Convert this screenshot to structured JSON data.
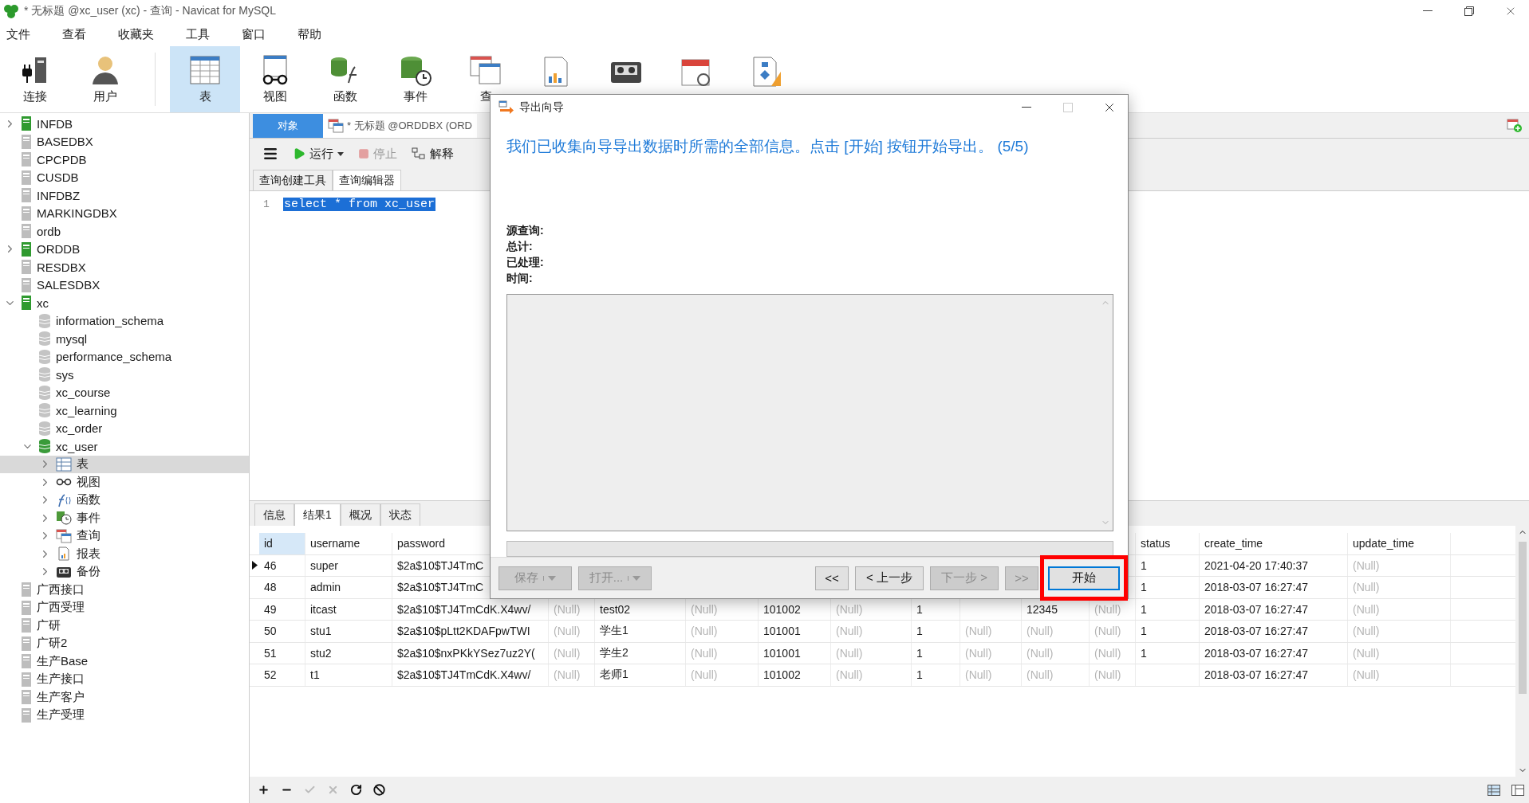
{
  "window": {
    "title": "* 无标题 @xc_user (xc) - 查询 - Navicat for MySQL"
  },
  "menu": [
    "文件",
    "查看",
    "收藏夹",
    "工具",
    "窗口",
    "帮助"
  ],
  "toolbar": [
    {
      "label": "连接",
      "selected": false
    },
    {
      "label": "用户",
      "selected": false
    },
    {
      "label": "表",
      "selected": true
    },
    {
      "label": "视图",
      "selected": false
    },
    {
      "label": "函数",
      "selected": false
    },
    {
      "label": "事件",
      "selected": false
    },
    {
      "label": "查",
      "selected": false
    },
    {
      "selected": false
    },
    {
      "selected": false
    },
    {
      "selected": false
    },
    {
      "selected": false
    }
  ],
  "tree": [
    {
      "label": "INFDB",
      "kind": "connection",
      "active": true,
      "expanded": false,
      "selected": false
    },
    {
      "label": "BASEDBX",
      "kind": "connection",
      "active": false,
      "selected": false
    },
    {
      "label": "CPCPDB",
      "kind": "connection",
      "active": false,
      "selected": false
    },
    {
      "label": "CUSDB",
      "kind": "connection",
      "active": false,
      "selected": false
    },
    {
      "label": "INFDBZ",
      "kind": "connection",
      "active": false,
      "selected": false
    },
    {
      "label": "MARKINGDBX",
      "kind": "connection",
      "active": false,
      "selected": false
    },
    {
      "label": "ordb",
      "kind": "connection",
      "active": false,
      "selected": false
    },
    {
      "label": "ORDDB",
      "kind": "connection",
      "active": true,
      "expanded": false,
      "selected": false
    },
    {
      "label": "RESDBX",
      "kind": "connection",
      "active": false,
      "selected": false
    },
    {
      "label": "SALESDBX",
      "kind": "connection",
      "active": false,
      "selected": false
    },
    {
      "label": "xc",
      "kind": "connection",
      "active": true,
      "expanded": true,
      "selected": false,
      "children": [
        {
          "label": "information_schema",
          "kind": "database",
          "active": false,
          "selected": false
        },
        {
          "label": "mysql",
          "kind": "database",
          "active": false,
          "selected": false
        },
        {
          "label": "performance_schema",
          "kind": "database",
          "active": false,
          "selected": false
        },
        {
          "label": "sys",
          "kind": "database",
          "active": false,
          "selected": false
        },
        {
          "label": "xc_course",
          "kind": "database",
          "active": false,
          "selected": false
        },
        {
          "label": "xc_learning",
          "kind": "database",
          "active": false,
          "selected": false
        },
        {
          "label": "xc_order",
          "kind": "database",
          "active": false,
          "selected": false
        },
        {
          "label": "xc_user",
          "kind": "database",
          "active": true,
          "expanded": true,
          "selected": false,
          "children": [
            {
              "label": "表",
              "kind": "category",
              "expanded": false,
              "selected": true
            },
            {
              "label": "视图",
              "kind": "category",
              "expanded": false,
              "selected": false
            },
            {
              "label": "函数",
              "kind": "category",
              "expanded": false,
              "selected": false
            },
            {
              "label": "事件",
              "kind": "category",
              "expanded": false,
              "selected": false
            },
            {
              "label": "查询",
              "kind": "category",
              "expanded": false,
              "selected": false
            },
            {
              "label": "报表",
              "kind": "category",
              "expanded": false,
              "selected": false
            },
            {
              "label": "备份",
              "kind": "category",
              "expanded": false,
              "selected": false
            }
          ]
        }
      ]
    },
    {
      "label": "广西接口",
      "kind": "connection",
      "active": false,
      "selected": false
    },
    {
      "label": "广西受理",
      "kind": "connection",
      "active": false,
      "selected": false
    },
    {
      "label": "广研",
      "kind": "connection",
      "active": false,
      "selected": false
    },
    {
      "label": "广研2",
      "kind": "connection",
      "active": false,
      "selected": false
    },
    {
      "label": "生产Base",
      "kind": "connection",
      "active": false,
      "selected": false
    },
    {
      "label": "生产接口",
      "kind": "connection",
      "active": false,
      "selected": false
    },
    {
      "label": "生产客户",
      "kind": "connection",
      "active": false,
      "selected": false
    },
    {
      "label": "生产受理",
      "kind": "connection",
      "active": false,
      "selected": false
    }
  ],
  "tabs": [
    {
      "label": "对象",
      "selected": true
    },
    {
      "label": "* 无标题 @ORDDBX (ORD",
      "selected": false
    }
  ],
  "query_toolbar": [
    {
      "label": "运行",
      "kind": "run",
      "disabled": false
    },
    {
      "label": "停止",
      "kind": "stop",
      "disabled": true
    },
    {
      "label": "解释",
      "kind": "explain",
      "disabled": false
    }
  ],
  "editor_tabs": [
    {
      "label": "查询创建工具",
      "selected": false
    },
    {
      "label": "查询编辑器",
      "selected": true
    }
  ],
  "editor": {
    "lines": [
      {
        "number": "1",
        "text": "select * from xc_user",
        "selected": true
      }
    ]
  },
  "result_tabs": [
    {
      "label": "信息",
      "selected": false
    },
    {
      "label": "结果1",
      "selected": true
    },
    {
      "label": "概况",
      "selected": false
    },
    {
      "label": "状态",
      "selected": false
    }
  ],
  "table": {
    "columns": [
      {
        "label": "id",
        "selected": true
      },
      {
        "label": "username",
        "selected": false
      },
      {
        "label": "password",
        "selected": false
      },
      null,
      null,
      null,
      null,
      null,
      null,
      null,
      null,
      null,
      {
        "label": "status",
        "selected": false
      },
      {
        "label": "create_time",
        "selected": false
      },
      {
        "label": "update_time",
        "selected": false
      }
    ],
    "rows": [
      {
        "current": true,
        "cells": [
          "46",
          "super",
          "$2a$10$TJ4TmC",
          null,
          null,
          null,
          null,
          null,
          null,
          null,
          null,
          null,
          "1",
          "2021-04-20 17:40:37",
          {
            "text": "(Null)",
            "kind": "null"
          }
        ]
      },
      {
        "current": false,
        "cells": [
          "48",
          "admin",
          "$2a$10$TJ4TmC",
          null,
          null,
          null,
          null,
          null,
          null,
          null,
          null,
          null,
          "1",
          "2018-03-07 16:27:47",
          {
            "text": "(Null)",
            "kind": "null"
          }
        ]
      },
      {
        "current": false,
        "cells": [
          "49",
          "itcast",
          "$2a$10$TJ4TmCdK.X4wv/",
          {
            "text": "(Null)",
            "kind": "null"
          },
          "test02",
          {
            "text": "(Null)",
            "kind": "null"
          },
          "101002",
          {
            "text": "(Null)",
            "kind": "null"
          },
          "1",
          null,
          "12345",
          {
            "text": "(Null)",
            "kind": "null"
          },
          "1",
          "2018-03-07 16:27:47",
          {
            "text": "(Null)",
            "kind": "null"
          }
        ]
      },
      {
        "current": false,
        "cells": [
          "50",
          "stu1",
          "$2a$10$pLtt2KDAFpwTWI",
          {
            "text": "(Null)",
            "kind": "null"
          },
          "学生1",
          {
            "text": "(Null)",
            "kind": "null"
          },
          "101001",
          {
            "text": "(Null)",
            "kind": "null"
          },
          "1",
          {
            "text": "(Null)",
            "kind": "null"
          },
          {
            "text": "(Null)",
            "kind": "null"
          },
          {
            "text": "(Null)",
            "kind": "null"
          },
          "1",
          "2018-03-07 16:27:47",
          {
            "text": "(Null)",
            "kind": "null"
          }
        ]
      },
      {
        "current": false,
        "cells": [
          "51",
          "stu2",
          "$2a$10$nxPKkYSez7uz2Y(",
          {
            "text": "(Null)",
            "kind": "null"
          },
          "学生2",
          {
            "text": "(Null)",
            "kind": "null"
          },
          "101001",
          {
            "text": "(Null)",
            "kind": "null"
          },
          "1",
          {
            "text": "(Null)",
            "kind": "null"
          },
          {
            "text": "(Null)",
            "kind": "null"
          },
          {
            "text": "(Null)",
            "kind": "null"
          },
          "1",
          "2018-03-07 16:27:47",
          {
            "text": "(Null)",
            "kind": "null"
          }
        ]
      },
      {
        "current": false,
        "cells": [
          "52",
          "t1",
          "$2a$10$TJ4TmCdK.X4wv/",
          {
            "text": "(Null)",
            "kind": "null"
          },
          "老师1",
          {
            "text": "(Null)",
            "kind": "null"
          },
          "101002",
          {
            "text": "(Null)",
            "kind": "null"
          },
          "1",
          {
            "text": "(Null)",
            "kind": "null"
          },
          {
            "text": "(Null)",
            "kind": "null"
          },
          {
            "text": "(Null)",
            "kind": "null"
          },
          null,
          "2018-03-07 16:27:47",
          {
            "text": "(Null)",
            "kind": "null"
          }
        ]
      }
    ]
  },
  "bottom_toolbar": [
    {
      "kind": "add",
      "disabled": false
    },
    {
      "kind": "remove",
      "disabled": false
    },
    {
      "kind": "apply",
      "disabled": true
    },
    {
      "kind": "discard",
      "disabled": true
    },
    {
      "kind": "refresh",
      "disabled": false
    },
    {
      "kind": "stop",
      "disabled": false
    }
  ],
  "dialog": {
    "title": "导出向导",
    "heading": "我们已收集向导导出数据时所需的全部信息。点击 [开始] 按钮开始导出。 (5/5)",
    "fields": [
      "源查询:",
      "总计:",
      "已处理:",
      "时间:"
    ],
    "progress": {
      "level": 0
    },
    "buttons": [
      {
        "label": "保存",
        "kind": "split",
        "disabled": true,
        "focused": false,
        "highlighted": false
      },
      {
        "label": "打开...",
        "kind": "split",
        "disabled": true,
        "focused": false,
        "highlighted": false
      },
      {
        "label": "<<",
        "kind": "plain",
        "disabled": false,
        "focused": false,
        "highlighted": false
      },
      {
        "label": "< 上一步",
        "kind": "plain",
        "disabled": false,
        "focused": false,
        "highlighted": false
      },
      {
        "label": "下一步 >",
        "kind": "plain",
        "disabled": true,
        "focused": false,
        "highlighted": false
      },
      {
        "label": ">>",
        "kind": "plain",
        "disabled": true,
        "focused": false,
        "highlighted": false
      },
      {
        "label": "开始",
        "kind": "plain",
        "disabled": false,
        "focused": true,
        "highlighted": true
      }
    ]
  }
}
